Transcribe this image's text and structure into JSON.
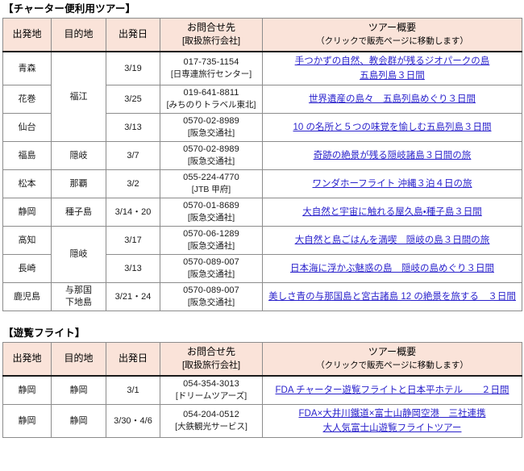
{
  "sections": [
    {
      "title": "【チャーター便利用ツアー】",
      "name": "charter-flight-tours",
      "columns": {
        "departure": "出発地",
        "destination": "目的地",
        "departure_date": "出発日",
        "contact_main": "お問合せ先",
        "contact_sub": "[取扱旅行会社]",
        "tour_main": "ツアー概要",
        "tour_sub": "（クリックで販売ページに移動します）"
      },
      "rows": [
        {
          "departure": "青森",
          "destination": "福江",
          "destination_rowspan": 3,
          "date": "3/19",
          "phone": "017-735-1154",
          "agency": "[日専連旅行センター]",
          "tour_lines": [
            "手つかずの自然、教会群が残るジオパークの島",
            "五島列島３日間"
          ]
        },
        {
          "departure": "花巻",
          "destination": "",
          "destination_rowspan": 0,
          "date": "3/25",
          "phone": "019-641-8811",
          "agency": "[みちのりトラベル東北]",
          "tour_lines": [
            "世界遺産の島々　五島列島めぐり３日間"
          ]
        },
        {
          "departure": "仙台",
          "destination": "",
          "destination_rowspan": 0,
          "date": "3/13",
          "phone": "0570-02-8989",
          "agency": "[阪急交通社]",
          "tour_lines": [
            "10 の名所と５つの味覚を愉しむ五島列島３日間"
          ]
        },
        {
          "departure": "福島",
          "destination": "隠岐",
          "destination_rowspan": 1,
          "date": "3/7",
          "phone": "0570-02-8989",
          "agency": "[阪急交通社]",
          "tour_lines": [
            "奇跡の絶景が残る隠岐諸島３日間の旅"
          ]
        },
        {
          "departure": "松本",
          "destination": "那覇",
          "destination_rowspan": 1,
          "date": "3/2",
          "phone": "055-224-4770",
          "agency": "[JTB 甲府]",
          "tour_lines": [
            "ワンダホーフライト 沖縄３泊４日の旅"
          ]
        },
        {
          "departure": "静岡",
          "destination": "種子島",
          "destination_rowspan": 1,
          "date": "3/14・20",
          "phone": "0570-01-8689",
          "agency": "[阪急交通社]",
          "tour_lines": [
            "大自然と宇宙に触れる屋久島・種子島３日間"
          ]
        },
        {
          "departure": "高知",
          "destination": "隠岐",
          "destination_rowspan": 2,
          "date": "3/17",
          "phone": "0570-06-1289",
          "agency": "[阪急交通社]",
          "tour_lines": [
            "大自然と島ごはんを満喫　隠岐の島３日間の旅"
          ]
        },
        {
          "departure": "長崎",
          "destination": "",
          "destination_rowspan": 0,
          "date": "3/13",
          "phone": "0570-089-007",
          "agency": "[阪急交通社]",
          "tour_lines": [
            "日本海に浮かぶ魅惑の島　隠岐の島めぐり３日間"
          ]
        },
        {
          "departure": "鹿児島",
          "destination": "与那国\n下地島",
          "destination_lines": [
            "与那国",
            "下地島"
          ],
          "destination_rowspan": 1,
          "date": "3/21・24",
          "phone": "0570-089-007",
          "agency": "[阪急交通社]",
          "tour_lines": [
            "美しさ青の与那国島と宮古諸島 12 の絶景を旅する　３日間"
          ]
        }
      ]
    },
    {
      "title": "【遊覧フライト】",
      "name": "sightseeing-flights",
      "columns": {
        "departure": "出発地",
        "destination": "目的地",
        "departure_date": "出発日",
        "contact_main": "お問合せ先",
        "contact_sub": "[取扱旅行会社]",
        "tour_main": "ツアー概要",
        "tour_sub": "（クリックで販売ページに移動します）"
      },
      "rows": [
        {
          "departure": "静岡",
          "destination": "静岡",
          "destination_rowspan": 1,
          "date": "3/1",
          "phone": "054-354-3013",
          "agency": "[ドリームツアーズ]",
          "tour_lines": [
            "FDA チャーター遊覧フライトと日本平ホテル　　２日間"
          ]
        },
        {
          "departure": "静岡",
          "destination": "静岡",
          "destination_rowspan": 1,
          "date": "3/30・4/6",
          "phone": "054-204-0512",
          "agency": "[大鉄観光サービス]",
          "tour_lines": [
            "FDA×大井川鐵道×富士山静岡空港　三社連携",
            "大人気富士山遊覧フライトツアー"
          ]
        }
      ]
    }
  ],
  "colors": {
    "header_background": "#FAE3D9",
    "link_text": "#2A22CC",
    "border": "#8C8C8C",
    "header_rule": "#1A1A1A",
    "page_background": "#FFFFFF"
  }
}
